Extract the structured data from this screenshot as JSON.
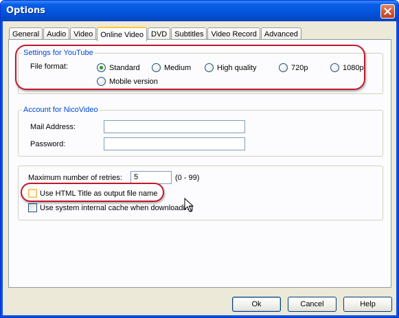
{
  "window": {
    "title": "Options"
  },
  "tabs": [
    "General",
    "Audio",
    "Video",
    "Online Video",
    "DVD",
    "Subtitles",
    "Video Record",
    "Advanced"
  ],
  "active_tab": "Online Video",
  "youtube": {
    "group_title": "Settings for YouTube",
    "file_format_label": "File format:",
    "options": [
      "Standard",
      "Medium",
      "High quality",
      "720p",
      "1080p",
      "Mobile version"
    ],
    "selected": "Standard"
  },
  "nico": {
    "group_title": "Account for NicoVideo",
    "mail_label": "Mail Address:",
    "mail_value": "",
    "password_label": "Password:",
    "password_value": ""
  },
  "misc": {
    "retries_label": "Maximum number of retries:",
    "retries_value": "5",
    "retries_range": "(0 - 99)",
    "html_title_label": "Use HTML Title as output file name",
    "html_title_checked": false,
    "cache_label": "Use system internal cache when downloading",
    "cache_checked": false
  },
  "buttons": {
    "ok": "Ok",
    "cancel": "Cancel",
    "help": "Help"
  },
  "colors": {
    "annotation": "#c0182b",
    "group_title": "#0046d5",
    "titlebar": "#0456e0"
  }
}
